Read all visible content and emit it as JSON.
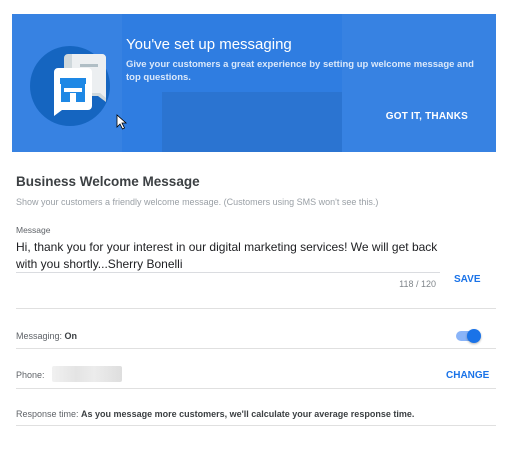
{
  "banner": {
    "title": "You've set up messaging",
    "description": "Give your customers a great experience by setting up welcome message and top questions.",
    "button_label": "GOT IT, THANKS",
    "icon": "storefront-chat-icon",
    "bg_color": "#2f7de1"
  },
  "welcome": {
    "title": "Business Welcome Message",
    "hint": "Show your customers a friendly welcome message. (Customers using SMS won't see this.)",
    "message_label": "Message",
    "message_text": "Hi, thank you for your interest in our digital marketing services! We will get back with you shortly...Sherry Bonelli",
    "counter": "118 / 120",
    "save_label": "SAVE"
  },
  "messaging": {
    "label": "Messaging:",
    "value": "On",
    "toggle_on": true
  },
  "phone": {
    "label": "Phone:",
    "change_label": "CHANGE"
  },
  "response": {
    "label": "Response time:",
    "value": "As you message more customers, we'll calculate your average response time."
  },
  "colors": {
    "accent": "#1a73e8",
    "banner": "#2f7de1"
  }
}
